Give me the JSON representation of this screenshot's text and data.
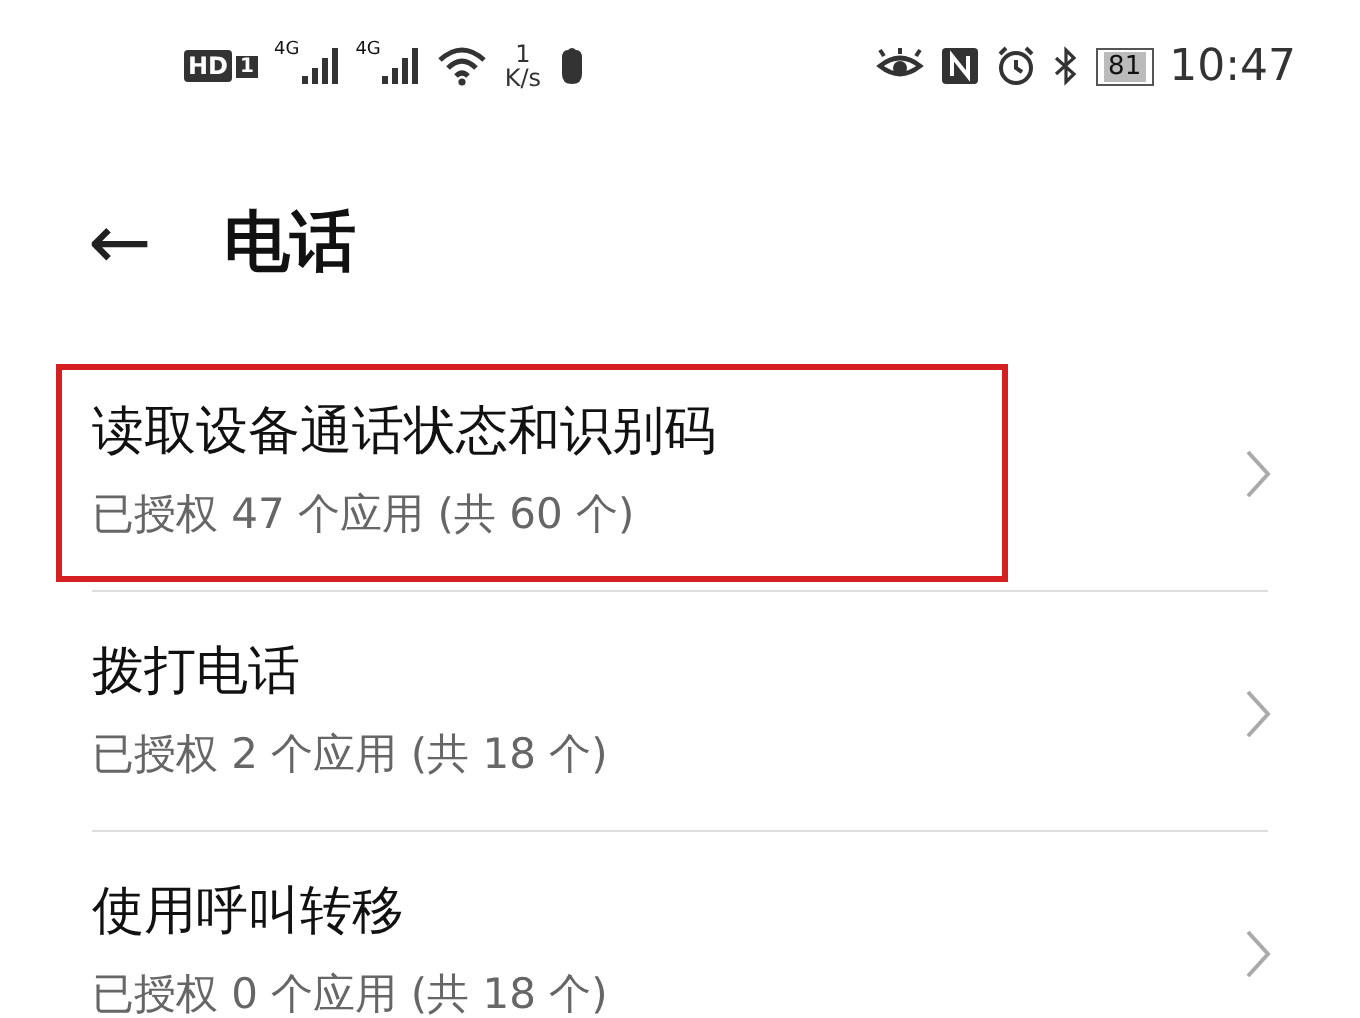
{
  "status_bar": {
    "hd": "HD",
    "sim": "1",
    "signals": [
      {
        "label": "4G"
      },
      {
        "label": "4G"
      }
    ],
    "speed_value": "1",
    "speed_unit": "K/s",
    "battery": "81",
    "time": "10:47"
  },
  "header": {
    "back": "←",
    "title": "电话"
  },
  "items": [
    {
      "title": "读取设备通话状态和识别码",
      "subtitle": "已授权 47 个应用 (共 60 个)",
      "highlighted": true
    },
    {
      "title": "拨打电话",
      "subtitle": "已授权 2 个应用 (共 18 个)",
      "highlighted": false
    },
    {
      "title": "使用呼叫转移",
      "subtitle": "已授权 0 个应用 (共 18 个)",
      "highlighted": false
    }
  ]
}
